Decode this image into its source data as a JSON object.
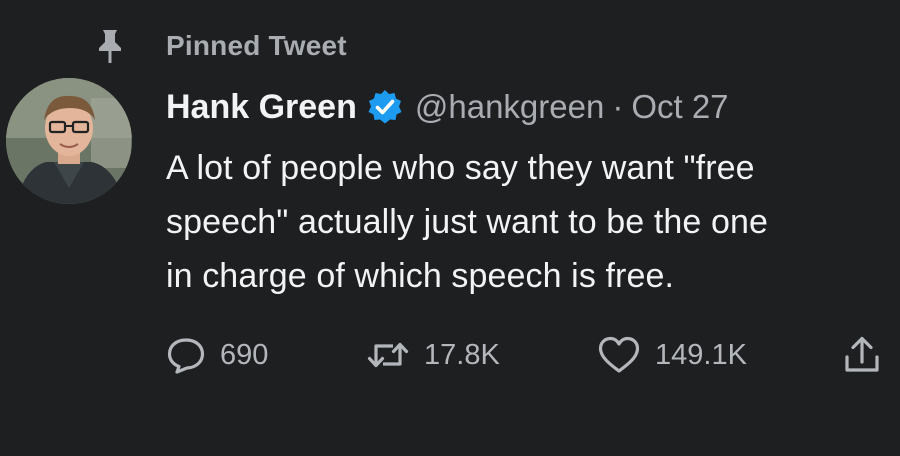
{
  "pinned": {
    "label": "Pinned Tweet",
    "icon": "pin-icon"
  },
  "author": {
    "name": "Hank Green",
    "handle": "@hankgreen",
    "separator": "·",
    "date": "Oct 27",
    "verified_icon": "verified-badge-icon",
    "verified_color": "#1d9bf0"
  },
  "tweet": {
    "text": "A lot of people who say they want \"free\nspeech\" actually just want to be the one\nin charge of which speech is free."
  },
  "actions": {
    "reply": {
      "icon": "reply-icon",
      "count": "690"
    },
    "retweet": {
      "icon": "retweet-icon",
      "count": "17.8K"
    },
    "like": {
      "icon": "heart-icon",
      "count": "149.1K"
    },
    "share": {
      "icon": "share-icon"
    }
  },
  "colors": {
    "background": "#1e1f21",
    "primary_text": "#f2f3f4",
    "secondary_text": "#a9adb2"
  }
}
